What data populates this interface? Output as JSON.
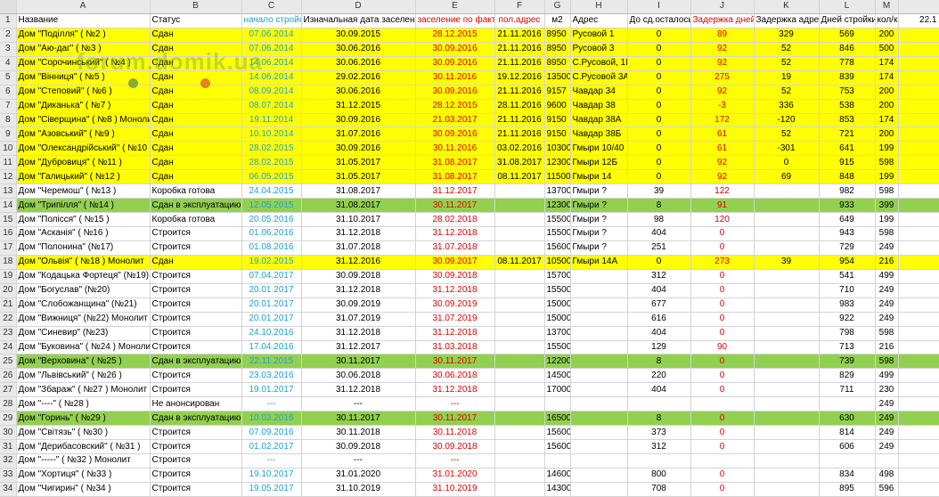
{
  "columns": [
    "A",
    "B",
    "C",
    "D",
    "E",
    "F",
    "G",
    "H",
    "I",
    "J",
    "K",
    "L",
    "M",
    ""
  ],
  "header": {
    "row": "1",
    "name": "Название",
    "status": "Статус",
    "start": "начало стройки",
    "orig_date": "Изначальная дата заселения",
    "actual": "заселение по факту",
    "addr_date": "пол.адрес",
    "m2": "м2",
    "address": "Адрес",
    "remaining": "До сд.осталось",
    "delay_days": "Задержка дней",
    "delay_addr": "Задержка адреса",
    "build_days": "Дней стройки",
    "flats": "кол/кв",
    "extra": "22.1"
  },
  "rows": [
    {
      "n": "2",
      "hl": "yellow",
      "name": "Дом \"Поділля\" ( №2 )",
      "status": "Сдан",
      "start": "07.06.2014",
      "orig": "30.09.2015",
      "actual": "28.12.2015",
      "addr": "21.11.2016",
      "m2": "8950",
      "address": "Русовой 1",
      "rem": "0",
      "delay": "89",
      "daddr": "329",
      "build": "569",
      "flats": "200"
    },
    {
      "n": "3",
      "hl": "yellow",
      "name": "Дом \"Аю-даг\" ( №3 )",
      "status": "Сдан",
      "start": "07.06.2014",
      "orig": "30.06.2016",
      "actual": "30.09.2016",
      "addr": "21.11.2016",
      "m2": "8950",
      "address": "Русовой 3",
      "rem": "0",
      "delay": "92",
      "daddr": "52",
      "build": "846",
      "flats": "500"
    },
    {
      "n": "4",
      "hl": "yellow",
      "name": "Дом \"Сорочинський\" ( №4 )",
      "status": "Сдан",
      "start": "14.06.2014",
      "orig": "30.06.2016",
      "actual": "30.09.2016",
      "addr": "21.11.2016",
      "m2": "8950",
      "address": "С.Русовой, 1І",
      "rem": "0",
      "delay": "92",
      "daddr": "52",
      "build": "778",
      "flats": "174"
    },
    {
      "n": "5",
      "hl": "yellow",
      "name": "Дом \"Вінниця\" ( №5 )",
      "status": "Сдан",
      "start": "14.06.2014",
      "orig": "29.02.2016",
      "actual": "30.11.2016",
      "addr": "19.12.2016",
      "m2": "13500",
      "address": "С.Русовой 3А",
      "rem": "0",
      "delay": "275",
      "daddr": "19",
      "build": "839",
      "flats": "174"
    },
    {
      "n": "6",
      "hl": "yellow",
      "name": "Дом \"Степовий\" ( №6 )",
      "status": "Сдан",
      "start": "08.09.2014",
      "orig": "30.06.2016",
      "actual": "30.09.2016",
      "addr": "21.11.2016",
      "m2": "9157",
      "address": "Чавдар 34",
      "rem": "0",
      "delay": "92",
      "daddr": "52",
      "build": "753",
      "flats": "200"
    },
    {
      "n": "7",
      "hl": "yellow",
      "name": "Дом \"Диканька\" ( №7 )",
      "status": "Сдан",
      "start": "08.07.2014",
      "orig": "31.12.2015",
      "actual": "28.12.2015",
      "addr": "28.11.2016",
      "m2": "9600",
      "address": "Чавдар 38",
      "rem": "0",
      "delay": "-3",
      "daddr": "336",
      "build": "538",
      "flats": "200"
    },
    {
      "n": "8",
      "hl": "yellow",
      "name": "Дом \"Сіверщина\" ( №8 ) Монолит",
      "status": "Сдан",
      "start": "19.11.2014",
      "orig": "30.09.2016",
      "actual": "21.03.2017",
      "addr": "21.11.2016",
      "m2": "9150",
      "address": "Чавдар 38А",
      "rem": "0",
      "delay": "172",
      "daddr": "-120",
      "build": "853",
      "flats": "174"
    },
    {
      "n": "9",
      "hl": "yellow",
      "name": "Дом \"Азовський\" ( №9 )",
      "status": "Сдан",
      "start": "10.10.2014",
      "orig": "31.07.2016",
      "actual": "30.09.2016",
      "addr": "21.11.2016",
      "m2": "9150",
      "address": "Чавдар 38Б",
      "rem": "0",
      "delay": "61",
      "daddr": "52",
      "build": "721",
      "flats": "200"
    },
    {
      "n": "10",
      "hl": "yellow",
      "name": "Дом \"Олександрійський\" ( №10 )",
      "status": "Сдан",
      "start": "28.02.2015",
      "orig": "30.09.2016",
      "actual": "30.11.2016",
      "addr": "03.02.2016",
      "m2": "10300",
      "address": "Гмыри 10/40",
      "rem": "0",
      "delay": "61",
      "daddr": "-301",
      "build": "641",
      "flats": "199"
    },
    {
      "n": "11",
      "hl": "yellow",
      "name": "Дом \"Дубровиця\" ( №11 )",
      "status": "Сдан",
      "start": "28.02.2015",
      "orig": "31.05.2017",
      "actual": "31.08.2017",
      "addr": "31.08.2017",
      "m2": "12300",
      "address": "Гмыри 12Б",
      "rem": "0",
      "delay": "92",
      "daddr": "0",
      "build": "915",
      "flats": "598"
    },
    {
      "n": "12",
      "hl": "yellow",
      "name": "Дом \"Галицький\" ( №12 )",
      "status": "Сдан",
      "start": "06.05.2015",
      "orig": "31.05.2017",
      "actual": "31.08.2017",
      "addr": "08.11.2017",
      "m2": "11500",
      "address": "Гмыри 14",
      "rem": "0",
      "delay": "92",
      "daddr": "69",
      "build": "848",
      "flats": "199"
    },
    {
      "n": "13",
      "hl": "",
      "name": "Дом \"Черемош\" ( №13 )",
      "status": "Коробка готова",
      "start": "24.04.2015",
      "orig": "31.08.2017",
      "actual": "31.12.2017",
      "addr": "",
      "m2": "13700",
      "address": "Гмыри ?",
      "rem": "39",
      "delay": "122",
      "daddr": "",
      "build": "982",
      "flats": "598"
    },
    {
      "n": "14",
      "hl": "green",
      "name": "Дом \"Трипілля\" ( №14 )",
      "status": "Сдан в эксплуатацию",
      "start": "12.05.2015",
      "orig": "31.08.2017",
      "actual": "30.11.2017",
      "addr": "",
      "m2": "12300",
      "address": "Гмыри ?",
      "rem": "8",
      "delay": "91",
      "daddr": "",
      "build": "933",
      "flats": "399"
    },
    {
      "n": "15",
      "hl": "",
      "name": "Дом \"Полісся\" ( №15 )",
      "status": "Коробка готова",
      "start": "20.05.2016",
      "orig": "31.10.2017",
      "actual": "28.02.2018",
      "addr": "",
      "m2": "15500",
      "address": "Гмыри ?",
      "rem": "98",
      "delay": "120",
      "daddr": "",
      "build": "649",
      "flats": "199"
    },
    {
      "n": "16",
      "hl": "",
      "name": "Дом \"Асканія\" ( №16 )",
      "status": "Строится",
      "start": "01.06.2016",
      "orig": "31.12.2018",
      "actual": "31.12.2018",
      "addr": "",
      "m2": "15500",
      "address": "Гмыри ?",
      "rem": "404",
      "delay": "0",
      "daddr": "",
      "build": "943",
      "flats": "598"
    },
    {
      "n": "17",
      "hl": "",
      "name": "Дом \"Полонина\" (№17)",
      "status": "Строится",
      "start": "01.08.2016",
      "orig": "31.07.2018",
      "actual": "31.07.2018",
      "addr": "",
      "m2": "15600",
      "address": "Гмыри ?",
      "rem": "251",
      "delay": "0",
      "daddr": "",
      "build": "729",
      "flats": "249"
    },
    {
      "n": "18",
      "hl": "yellow",
      "name": "Дом \"Ольвія\" ( №18 ) Монолит",
      "status": "Сдан",
      "start": "19.02.2015",
      "orig": "31.12.2016",
      "actual": "30.09.2017",
      "addr": "08.11.2017",
      "m2": "10500",
      "address": "Гмыри 14А",
      "rem": "0",
      "delay": "273",
      "daddr": "39",
      "build": "954",
      "flats": "216"
    },
    {
      "n": "19",
      "hl": "",
      "name": "Дом \"Кодацька Фортеця\" (№19)",
      "status": "Строится",
      "start": "07.04.2017",
      "orig": "30.09.2018",
      "actual": "30.09.2018",
      "addr": "",
      "m2": "15700",
      "address": "",
      "rem": "312",
      "delay": "0",
      "daddr": "",
      "build": "541",
      "flats": "499"
    },
    {
      "n": "20",
      "hl": "",
      "name": "Дом \"Богуслав\" (№20)",
      "status": "Строится",
      "start": "20.01.2017",
      "orig": "31.12.2018",
      "actual": "31.12.2018",
      "addr": "",
      "m2": "15500",
      "address": "",
      "rem": "404",
      "delay": "0",
      "daddr": "",
      "build": "710",
      "flats": "249"
    },
    {
      "n": "21",
      "hl": "",
      "name": "Дом \"Слобожанщина\" (№21)",
      "status": "Строится",
      "start": "20.01.2017",
      "orig": "30.09.2019",
      "actual": "30.09.2019",
      "addr": "",
      "m2": "15000",
      "address": "",
      "rem": "677",
      "delay": "0",
      "daddr": "",
      "build": "983",
      "flats": "249"
    },
    {
      "n": "22",
      "hl": "",
      "name": "Дом \"Вижниця\" (№22) Монолит",
      "status": "Строится",
      "start": "20.01.2017",
      "orig": "31.07.2019",
      "actual": "31.07.2019",
      "addr": "",
      "m2": "15000",
      "address": "",
      "rem": "616",
      "delay": "0",
      "daddr": "",
      "build": "922",
      "flats": "249"
    },
    {
      "n": "23",
      "hl": "",
      "name": "Дом \"Синевир\" (№23)",
      "status": "Строится",
      "start": "24.10.2016",
      "orig": "31.12.2018",
      "actual": "31.12.2018",
      "addr": "",
      "m2": "13700",
      "address": "",
      "rem": "404",
      "delay": "0",
      "daddr": "",
      "build": "798",
      "flats": "598"
    },
    {
      "n": "24",
      "hl": "",
      "name": "Дом \"Буковина\" ( №24 ) Монолит",
      "status": "Строится",
      "start": "17.04.2016",
      "orig": "31.12.2017",
      "actual": "31.03.2018",
      "addr": "",
      "m2": "15500",
      "address": "",
      "rem": "129",
      "delay": "90",
      "daddr": "",
      "build": "713",
      "flats": "216"
    },
    {
      "n": "25",
      "hl": "green",
      "name": "Дом \"Верховина\" ( №25 )",
      "status": "Сдан в эксплуатацию",
      "start": "22.11.2015",
      "orig": "30.11.2017",
      "actual": "30.11.2017",
      "addr": "",
      "m2": "12200",
      "address": "",
      "rem": "8",
      "delay": "0",
      "daddr": "",
      "build": "739",
      "flats": "598"
    },
    {
      "n": "26",
      "hl": "",
      "name": "Дом \"Львівський\" ( №26 )",
      "status": "Строится",
      "start": "23.03.2016",
      "orig": "30.06.2018",
      "actual": "30.06.2018",
      "addr": "",
      "m2": "14500",
      "address": "",
      "rem": "220",
      "delay": "0",
      "daddr": "",
      "build": "829",
      "flats": "499"
    },
    {
      "n": "27",
      "hl": "",
      "name": "Дом \"Збараж\" ( №27 ) Монолит",
      "status": "Строится",
      "start": "19.01.2017",
      "orig": "31.12.2018",
      "actual": "31.12.2018",
      "addr": "",
      "m2": "17000",
      "address": "",
      "rem": "404",
      "delay": "0",
      "daddr": "",
      "build": "711",
      "flats": "230"
    },
    {
      "n": "28",
      "hl": "",
      "name": "Дом \"----\" ( №28 )",
      "status": "Не анонсирован",
      "start": "---",
      "orig": "---",
      "actual": "---",
      "addr": "",
      "m2": "",
      "address": "",
      "rem": "",
      "delay": "",
      "daddr": "",
      "build": "",
      "flats": "249"
    },
    {
      "n": "29",
      "hl": "green",
      "name": "Дом \"Горинь\" ( №29 )",
      "status": "Сдан в эксплуатацию",
      "start": "10.03.2016",
      "orig": "30.11.2017",
      "actual": "30.11.2017",
      "addr": "",
      "m2": "16500",
      "address": "",
      "rem": "8",
      "delay": "0",
      "daddr": "",
      "build": "630",
      "flats": "249"
    },
    {
      "n": "30",
      "hl": "",
      "name": "Дом \"Світязь\" ( №30 )",
      "status": "Строится",
      "start": "07.09.2016",
      "orig": "30.11.2018",
      "actual": "30.11.2018",
      "addr": "",
      "m2": "15600",
      "address": "",
      "rem": "373",
      "delay": "0",
      "daddr": "",
      "build": "814",
      "flats": "249"
    },
    {
      "n": "31",
      "hl": "",
      "name": "Дом \"Дерибасовский\" ( №31 )",
      "status": "Строится",
      "start": "01.02.2017",
      "orig": "30.09.2018",
      "actual": "30.09.2018",
      "addr": "",
      "m2": "15600",
      "address": "",
      "rem": "312",
      "delay": "0",
      "daddr": "",
      "build": "606",
      "flats": "249"
    },
    {
      "n": "32",
      "hl": "",
      "name": "Дом \"-----\" ( №32 ) Монолит",
      "status": "Строится",
      "start": "---",
      "orig": "---",
      "actual": "---",
      "addr": "",
      "m2": "",
      "address": "",
      "rem": "",
      "delay": "",
      "daddr": "",
      "build": "",
      "flats": ""
    },
    {
      "n": "33",
      "hl": "",
      "name": "Дом \"Хортиця\" ( №33 )",
      "status": "Строится",
      "start": "19.10.2017",
      "orig": "31.01.2020",
      "actual": "31.01.2020",
      "addr": "",
      "m2": "14600",
      "address": "",
      "rem": "800",
      "delay": "0",
      "daddr": "",
      "build": "834",
      "flats": "498"
    },
    {
      "n": "34",
      "hl": "",
      "name": "Дом \"Чигирин\" ( №34 )",
      "status": "Строится",
      "start": "19.05.2017",
      "orig": "31.10.2019",
      "actual": "31.10.2019",
      "addr": "",
      "m2": "14300",
      "address": "",
      "rem": "708",
      "delay": "0",
      "daddr": "",
      "build": "895",
      "flats": "596"
    }
  ],
  "watermark": "forum.domik.ua"
}
